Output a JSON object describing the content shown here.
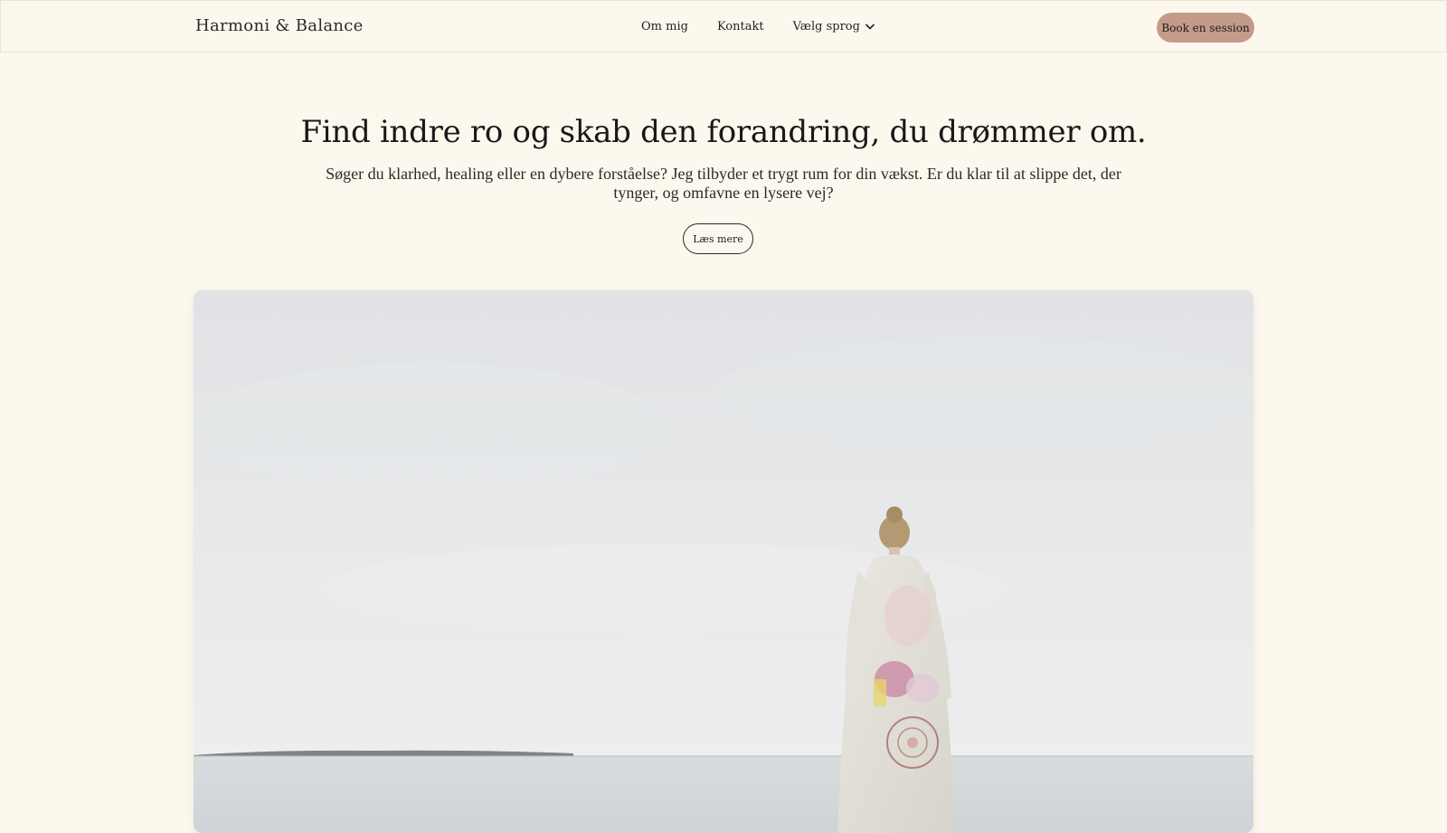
{
  "header": {
    "brand": "Harmoni & Balance",
    "nav": {
      "about": "Om mig",
      "contact": "Kontakt",
      "language": "Vælg sprog"
    },
    "cta": "Book en session"
  },
  "hero": {
    "title": "Find indre ro og skab den forandring, du drømmer om.",
    "subtitle": "Søger du klarhed, healing eller en dybere forståelse? Jeg tilbyder et trygt rum for din vækst. Er du klar til at slippe det, der tynger, og omfavne en lysere vej?",
    "button": "Læs mere"
  },
  "colors": {
    "background": "#fdf8ee",
    "accent": "#c49b8a",
    "text": "#1c1c1c"
  },
  "icons": {
    "language_dropdown": "chevron-down-icon"
  }
}
